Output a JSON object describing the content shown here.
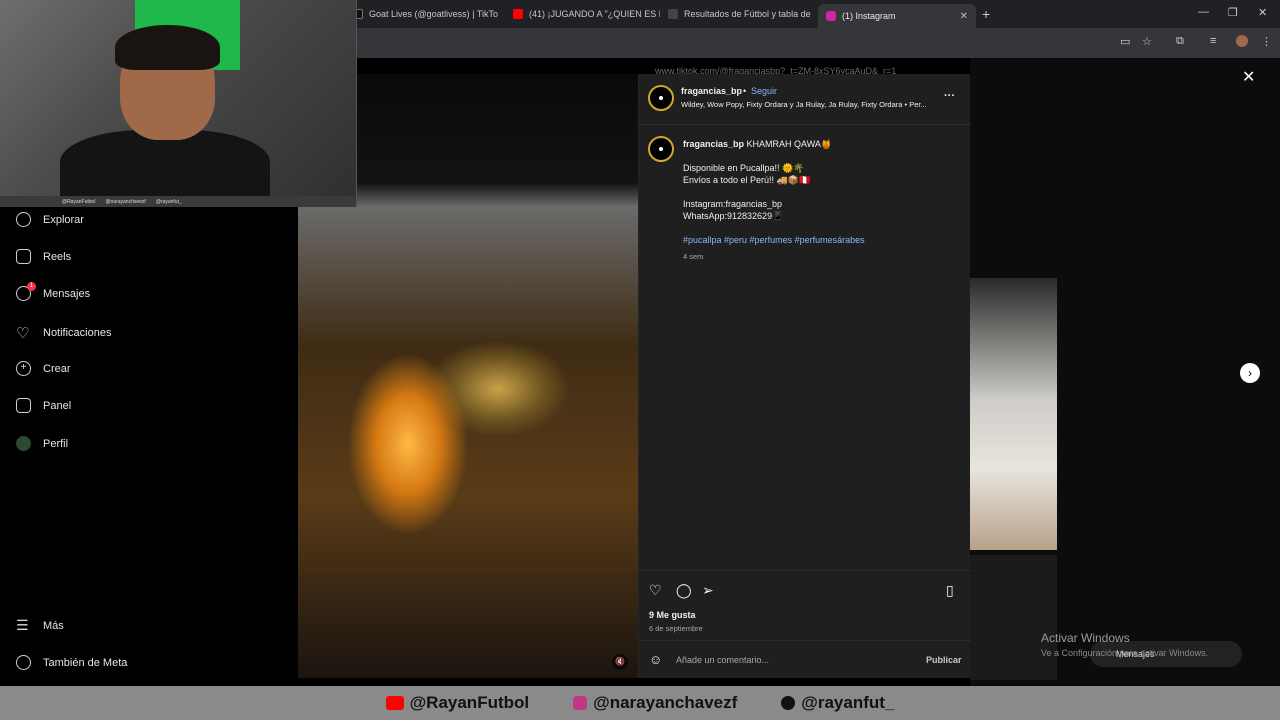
{
  "browser": {
    "tabs": [
      {
        "title": "Goat Lives (@goatlivess) | TikTo",
        "color": "#111111"
      },
      {
        "title": "(41) ¡JUGANDO A \"¿QUIEN ES E",
        "color": "#ff0000"
      },
      {
        "title": "Resultados de Fútbol y tabla de",
        "color": "#444444"
      },
      {
        "title": "(1) Instagram",
        "color": "#d6249f"
      }
    ],
    "new_tab": "+",
    "close_glyph": "✕",
    "window_controls": {
      "minimize": "—",
      "restore": "❐",
      "close": "✕"
    }
  },
  "background_page": {
    "tiktok_url": "www.tiktok.com/@fraganciasbp?_t=ZM-8xSY6ycaAuD&_r=1"
  },
  "webcam": {
    "tags": [
      "@RayanFutbol",
      "@narayanchavezf",
      "@rayanfut_"
    ]
  },
  "sidebar": {
    "items": [
      {
        "label": "Explorar",
        "icon": "compass-icon"
      },
      {
        "label": "Reels",
        "icon": "reels-icon"
      },
      {
        "label": "Mensajes",
        "icon": "messenger-icon",
        "badge": "1"
      },
      {
        "label": "Notificaciones",
        "icon": "heart-icon"
      },
      {
        "label": "Crear",
        "icon": "plus-icon"
      },
      {
        "label": "Panel",
        "icon": "dashboard-icon"
      },
      {
        "label": "Perfil",
        "icon": "profile-icon"
      }
    ],
    "more": "Más",
    "meta": "También de Meta"
  },
  "post": {
    "header": {
      "username": "fragancias_bp",
      "separator": "•",
      "follow": "Seguir",
      "audio": "Wildey, Wow Popy, Fixty Ordara y Ja Rulay, Ja Rulay, Fixty Ordara • Per..."
    },
    "caption": {
      "username": "fragancias_bp",
      "title": "KHAMRAH QAWA🍯",
      "lines": [
        "Disponible en Pucallpa!! 🌞🌴",
        "Envíos a todo el Perú!! 🚚📦🇵🇪",
        "",
        "Instagram:fragancias_bp",
        "WhatsApp:912832629📱"
      ],
      "hashtags": "#pucallpa #peru #perfumes #perfumesárabes",
      "age": "4 sem"
    },
    "likes": "9 Me gusta",
    "date": "6 de septiembre",
    "comment_placeholder": "Añade un comentario...",
    "publish": "Publicar",
    "more_options": "···"
  },
  "windows_watermark": {
    "title": "Activar Windows",
    "subtitle": "Ve a Configuración para activar Windows.",
    "messages_pill": "Mensajes"
  },
  "banner": [
    {
      "handle": "@RayanFutbol",
      "icon": "youtube-icon",
      "color": "#ff0000"
    },
    {
      "handle": "@narayanchavezf",
      "icon": "instagram-icon",
      "color": "#c13584"
    },
    {
      "handle": "@rayanfut_",
      "icon": "tiktok-icon",
      "color": "#111111"
    }
  ]
}
